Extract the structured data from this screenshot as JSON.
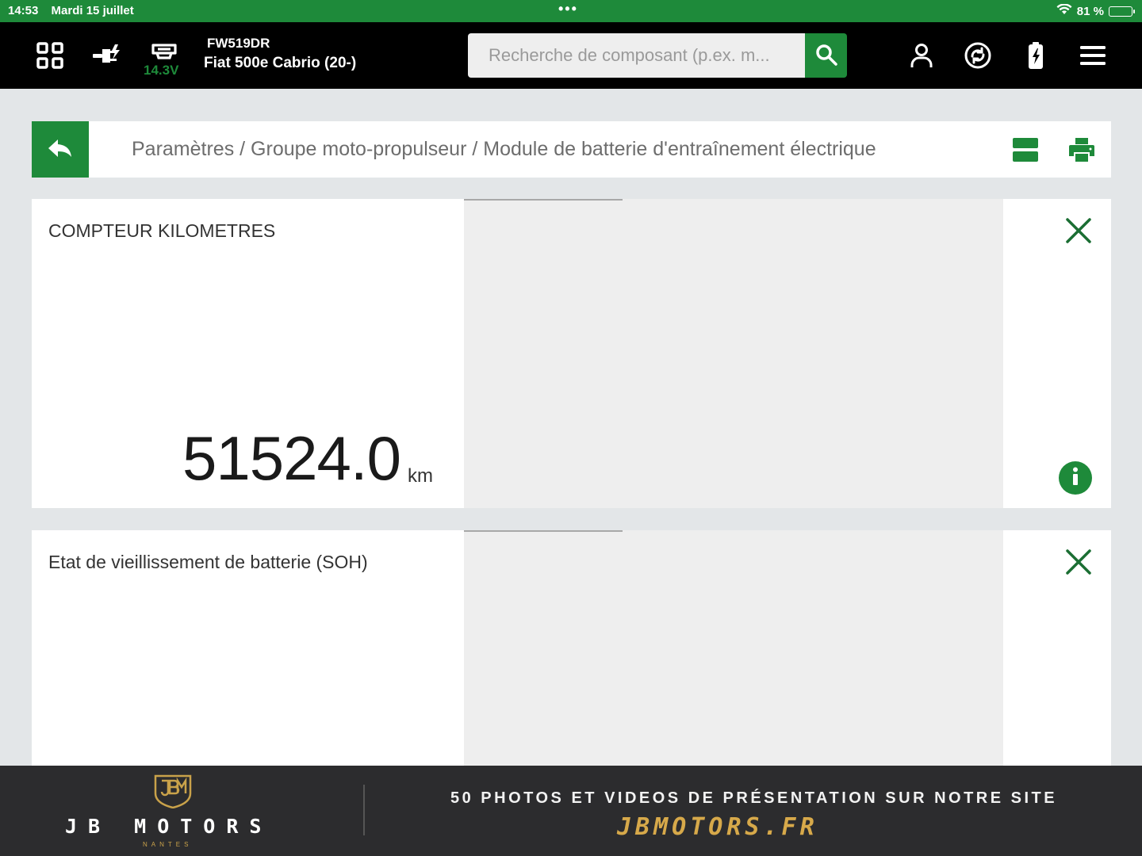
{
  "status_bar": {
    "time": "14:53",
    "date": "Mardi 15 juillet",
    "dots": "•••",
    "battery_percent": "81 %",
    "battery_level": 0.81
  },
  "top_nav": {
    "voltage": "14.3V",
    "vehicle_plate": "FW519DR",
    "vehicle_model": "Fiat 500e Cabrio (20-)",
    "search_placeholder": "Recherche de composant (p.ex. m..."
  },
  "breadcrumb": {
    "path": "Paramètres / Groupe moto-propulseur / Module de batterie d'entraînement électrique"
  },
  "cards": [
    {
      "title": "COMPTEUR KILOMETRES",
      "value": "51524.0",
      "unit": "km"
    },
    {
      "title": "Etat de vieillissement de batterie (SOH)"
    }
  ],
  "banner": {
    "brand": "JB MOTORS",
    "brand_sub": "NANTES",
    "promo": "50 PHOTOS ET VIDEOS DE PRÉSENTATION SUR NOTRE SITE",
    "site": "JBMOTORS.FR"
  },
  "colors": {
    "accent_green": "#1e8a3a",
    "nav_black": "#000000",
    "background": "#e3e6e8",
    "banner_gold": "#d7a94a"
  },
  "icons": {
    "nav": [
      "grid-icon",
      "connector-icon",
      "car-battery-icon",
      "search-icon",
      "user-icon",
      "sync-icon",
      "battery-charge-icon",
      "menu-icon"
    ],
    "breadcrumb": [
      "back-arrow-icon",
      "layout-toggle-icon",
      "print-icon"
    ],
    "card": [
      "close-icon",
      "info-icon"
    ]
  }
}
